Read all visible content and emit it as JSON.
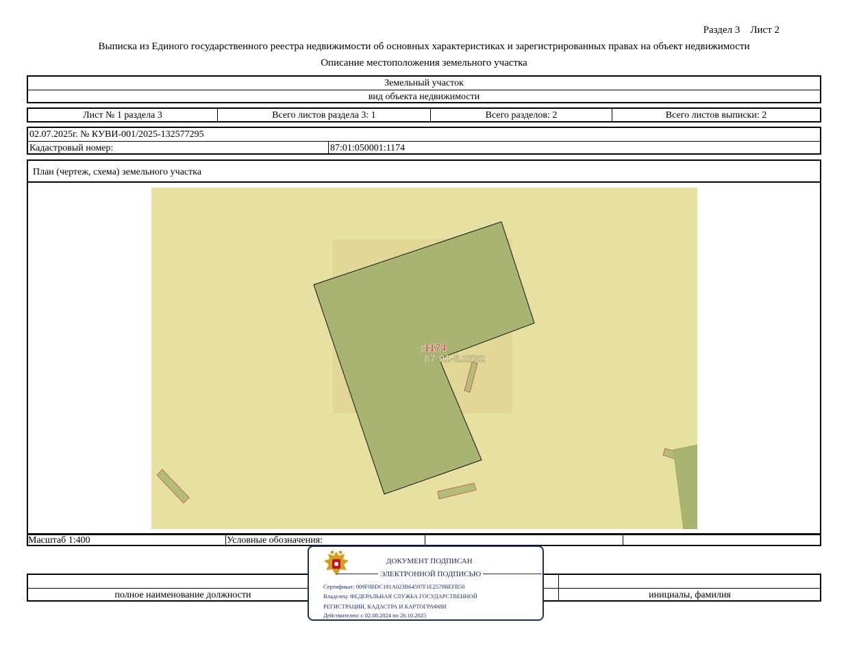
{
  "header": {
    "section_sheet": "Раздел 3    Лист 2",
    "title": "Выписка из Единого государственного реестра недвижимости об основных характеристиках и зарегистрированных правах на объект недвижимости",
    "subtitle": "Описание местоположения земельного участка"
  },
  "object": {
    "type": "Земельный участок",
    "type_label": "вид объекта недвижимости"
  },
  "sheets": {
    "sheet_of_section": "Лист № 1 раздела 3",
    "total_section_sheets": "Всего листов раздела 3: 1",
    "total_sections": "Всего разделов: 2",
    "total_extract_sheets": "Всего листов выписки: 2"
  },
  "record": {
    "date_number": "02.07.2025г. № КУВИ-001/2025-132577295",
    "cadastral_label": "Кадастровый номер:",
    "cadastral_value": "87:01:050001:1174"
  },
  "plan": {
    "title": "План (чертеж, схема) земельного участка",
    "parcel_label": ":1174",
    "zone_label": "87:01-6.2532",
    "colors": {
      "background": "#e6e0a1",
      "zone": "#e0d494",
      "parcel": "#a8b570",
      "building": "#b1bd78",
      "parcel_border": "#2d2d2d",
      "building_border": "#c0504d",
      "label_red": "#c9142c"
    }
  },
  "footer": {
    "scale": "Масштаб 1:400",
    "legend_label": "Условные обозначения:",
    "position_label": "полное наименование должности",
    "name_label": "инициалы, фамилия"
  },
  "stamp": {
    "line1": "ДОКУМЕНТ ПОДПИСАН",
    "line2": "ЭЛЕКТРОННОЙ ПОДПИСЬЮ",
    "certificate": "Сертификат: 009F0BDC181A023B64597F1E2579BEFB50",
    "owner1": "Владелец: ФЕДЕРАЛЬНАЯ СЛУЖБА ГОСУДАРСТВЕННОЙ",
    "owner2": "РЕГИСТРАЦИИ, КАДАСТРА И КАРТОГРАФИИ",
    "valid": "Действителен: с 02.08.2024 по 26.10.2025",
    "icon": "russian-coat-of-arms-icon"
  }
}
